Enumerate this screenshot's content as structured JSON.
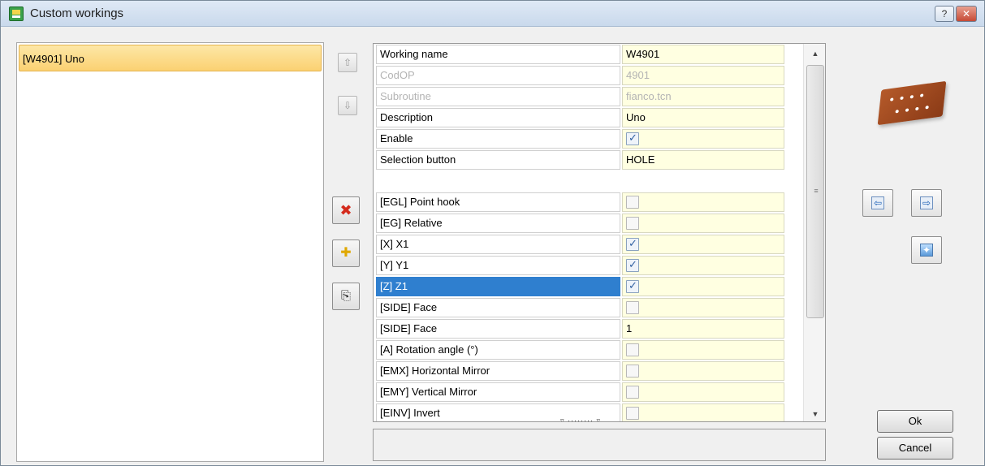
{
  "window": {
    "title": "Custom workings",
    "help_label": "?",
    "close_label": "✕"
  },
  "list": {
    "items": [
      "[W4901] Uno"
    ]
  },
  "side_buttons": {
    "up": "⇧",
    "down": "⇩",
    "delete": "✖",
    "new": "✚",
    "copy": "⎘"
  },
  "grid": {
    "rows": [
      {
        "name": "Working name",
        "value": "W4901",
        "kind": "text"
      },
      {
        "name": "CodOP",
        "value": "4901",
        "kind": "text",
        "disabled": true
      },
      {
        "name": "Subroutine",
        "value": "fianco.tcn",
        "kind": "text",
        "disabled": true
      },
      {
        "name": "Description",
        "value": "Uno",
        "kind": "text"
      },
      {
        "name": "Enable",
        "checked": true,
        "kind": "checkbox"
      },
      {
        "name": "Selection button",
        "value": "HOLE",
        "kind": "text"
      },
      {
        "kind": "blank"
      },
      {
        "name": "[EGL] Point hook",
        "checked": false,
        "kind": "checkbox"
      },
      {
        "name": "[EG] Relative",
        "checked": false,
        "kind": "checkbox"
      },
      {
        "name": "[X] X1",
        "checked": true,
        "kind": "checkbox"
      },
      {
        "name": "[Y] Y1",
        "checked": true,
        "kind": "checkbox"
      },
      {
        "name": "[Z] Z1",
        "checked": true,
        "kind": "checkbox",
        "selected": true
      },
      {
        "name": "[SIDE] Face",
        "checked": false,
        "kind": "checkbox"
      },
      {
        "name": "[SIDE] Face",
        "value": "1",
        "kind": "text"
      },
      {
        "name": "[A] Rotation angle (°)",
        "checked": false,
        "kind": "checkbox"
      },
      {
        "name": "[EMX] Horizontal Mirror",
        "checked": false,
        "kind": "checkbox"
      },
      {
        "name": "[EMY] Vertical Mirror",
        "checked": false,
        "kind": "checkbox"
      },
      {
        "name": "[EINV] Invert",
        "checked": false,
        "kind": "checkbox"
      }
    ]
  },
  "scrollbar": {
    "up_arrow": "▲",
    "down_arrow": "▼",
    "grip": "≡"
  },
  "splitter": {
    "handle": "▿ ········ ▿"
  },
  "nav": {
    "prev": "⇦",
    "next": "⇨",
    "image": "✦"
  },
  "buttons": {
    "ok": "Ok",
    "cancel": "Cancel"
  },
  "colors": {
    "selection": "#2f7fcf",
    "value_bg": "#ffffe1",
    "list_highlight": "#fbd172"
  }
}
